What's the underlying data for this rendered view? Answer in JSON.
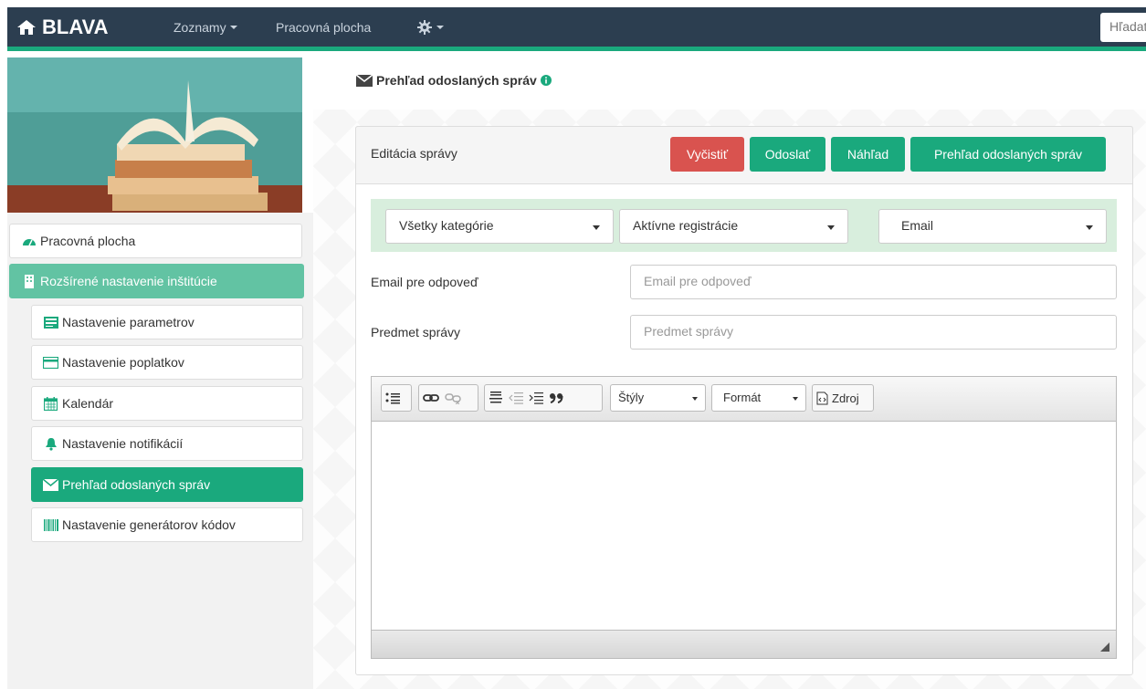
{
  "navbar": {
    "brand": "BLAVA",
    "menu_lists": "Zoznamy",
    "menu_dashboard": "Pracovná plocha",
    "search_placeholder": "Hľadať"
  },
  "sidebar": {
    "items": [
      {
        "label": "Pracovná plocha",
        "icon": "dashboard-icon"
      },
      {
        "label": "Rozšírené nastavenie inštitúcie",
        "icon": "building-icon"
      },
      {
        "label": "Nastavenie parametrov",
        "icon": "list-icon"
      },
      {
        "label": "Nastavenie poplatkov",
        "icon": "credit-card-icon"
      },
      {
        "label": "Kalendár",
        "icon": "calendar-icon"
      },
      {
        "label": "Nastavenie notifikácií",
        "icon": "bell-icon"
      },
      {
        "label": "Prehľad odoslaných správ",
        "icon": "envelope-icon"
      },
      {
        "label": "Nastavenie generátorov kódov",
        "icon": "barcode-icon"
      }
    ]
  },
  "page": {
    "title": "Prehľad odoslaných správ"
  },
  "panel": {
    "title": "Editácia správy",
    "btn_clear": "Vyčistiť",
    "btn_send": "Odoslať",
    "btn_preview": "Náhľad",
    "btn_overview": "Prehľad odoslaných správ"
  },
  "filters": {
    "category": "Všetky kategórie",
    "registrations": "Aktívne registrácie",
    "channel": "Email"
  },
  "form": {
    "reply_label": "Email pre odpoveď",
    "reply_placeholder": "Email pre odpoveď",
    "subject_label": "Predmet správy",
    "subject_placeholder": "Predmet správy"
  },
  "editor": {
    "styles": "Štýly",
    "format": "Formát",
    "source": "Zdroj"
  },
  "colors": {
    "navbar": "#2c3e50",
    "accent": "#1aa97d",
    "danger": "#d9534f"
  }
}
